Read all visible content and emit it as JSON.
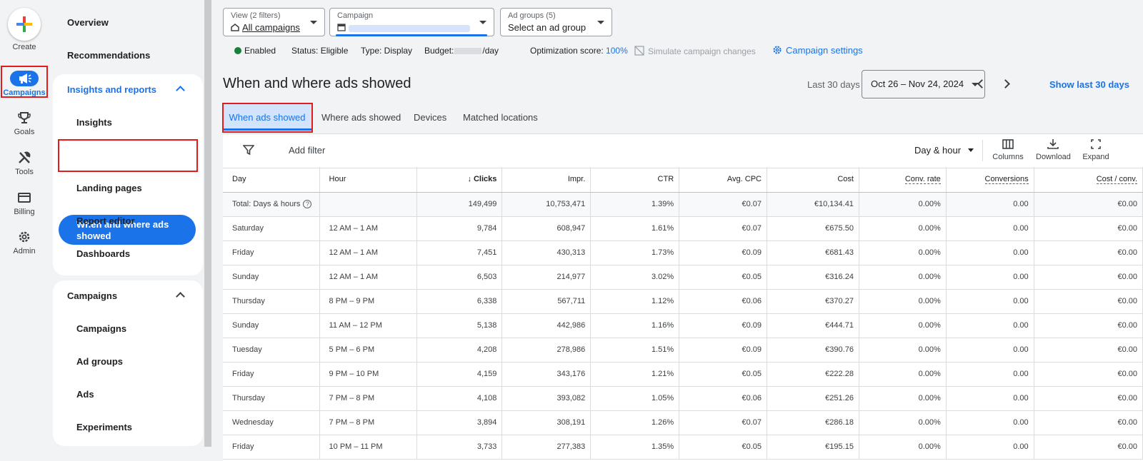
{
  "rail": {
    "create": "Create",
    "campaigns": "Campaigns",
    "goals": "Goals",
    "tools": "Tools",
    "billing": "Billing",
    "admin": "Admin"
  },
  "sidebar": {
    "overview": "Overview",
    "recommendations": "Recommendations",
    "insights_section": "Insights and reports",
    "insights_items": [
      "Insights",
      "When and where ads showed",
      "Landing pages",
      "Report editor",
      "Dashboards"
    ],
    "campaigns_section": "Campaigns",
    "campaigns_items": [
      "Campaigns",
      "Ad groups",
      "Ads",
      "Experiments"
    ]
  },
  "header": {
    "view_label": "View (2 filters)",
    "view_value": "All campaigns",
    "campaign_label": "Campaign",
    "adgroups_label": "Ad groups (5)",
    "adgroups_value": "Select an ad group"
  },
  "status": {
    "enabled": "Enabled",
    "status": "Status: Eligible",
    "type": "Type: Display",
    "budget_prefix": "Budget:",
    "budget_suffix": "/day",
    "opt_label": "Optimization score:",
    "opt_value": "100%",
    "simulate": "Simulate campaign changes",
    "settings": "Campaign settings"
  },
  "page": {
    "title": "When and where ads showed",
    "date_label": "Last 30 days",
    "date_range": "Oct 26 – Nov 24, 2024",
    "show_last": "Show last 30 days"
  },
  "tabs": [
    "When ads showed",
    "Where ads showed",
    "Devices",
    "Matched locations"
  ],
  "toolbar": {
    "add_filter": "Add filter",
    "segment": "Day & hour",
    "columns": "Columns",
    "download": "Download",
    "expand": "Expand"
  },
  "table": {
    "headers": [
      "Day",
      "Hour",
      "Clicks",
      "Impr.",
      "CTR",
      "Avg. CPC",
      "Cost",
      "Conv. rate",
      "Conversions",
      "Cost / conv."
    ],
    "total": [
      "Total: Days & hours",
      "",
      "149,499",
      "10,753,471",
      "1.39%",
      "€0.07",
      "€10,134.41",
      "0.00%",
      "0.00",
      "€0.00"
    ],
    "rows": [
      [
        "Saturday",
        "12 AM – 1 AM",
        "9,784",
        "608,947",
        "1.61%",
        "€0.07",
        "€675.50",
        "0.00%",
        "0.00",
        "€0.00"
      ],
      [
        "Friday",
        "12 AM – 1 AM",
        "7,451",
        "430,313",
        "1.73%",
        "€0.09",
        "€681.43",
        "0.00%",
        "0.00",
        "€0.00"
      ],
      [
        "Sunday",
        "12 AM – 1 AM",
        "6,503",
        "214,977",
        "3.02%",
        "€0.05",
        "€316.24",
        "0.00%",
        "0.00",
        "€0.00"
      ],
      [
        "Thursday",
        "8 PM – 9 PM",
        "6,338",
        "567,711",
        "1.12%",
        "€0.06",
        "€370.27",
        "0.00%",
        "0.00",
        "€0.00"
      ],
      [
        "Sunday",
        "11 AM – 12 PM",
        "5,138",
        "442,986",
        "1.16%",
        "€0.09",
        "€444.71",
        "0.00%",
        "0.00",
        "€0.00"
      ],
      [
        "Tuesday",
        "5 PM – 6 PM",
        "4,208",
        "278,986",
        "1.51%",
        "€0.09",
        "€390.76",
        "0.00%",
        "0.00",
        "€0.00"
      ],
      [
        "Friday",
        "9 PM – 10 PM",
        "4,159",
        "343,176",
        "1.21%",
        "€0.05",
        "€222.28",
        "0.00%",
        "0.00",
        "€0.00"
      ],
      [
        "Thursday",
        "7 PM – 8 PM",
        "4,108",
        "393,082",
        "1.05%",
        "€0.06",
        "€251.26",
        "0.00%",
        "0.00",
        "€0.00"
      ],
      [
        "Wednesday",
        "7 PM – 8 PM",
        "3,894",
        "308,191",
        "1.26%",
        "€0.07",
        "€286.18",
        "0.00%",
        "0.00",
        "€0.00"
      ],
      [
        "Friday",
        "10 PM – 11 PM",
        "3,733",
        "277,383",
        "1.35%",
        "€0.05",
        "€195.15",
        "0.00%",
        "0.00",
        "€0.00"
      ]
    ]
  },
  "colors": {
    "accent": "#1a73e8",
    "highlight_box": "#e21c1c",
    "enabled": "#188038"
  }
}
